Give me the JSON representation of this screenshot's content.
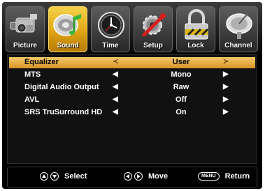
{
  "tabs": [
    {
      "label": "Picture",
      "icon": "camcorder-icon",
      "active": false
    },
    {
      "label": "Sound",
      "icon": "speaker-note-icon",
      "active": true
    },
    {
      "label": "Time",
      "icon": "clock-icon",
      "active": false
    },
    {
      "label": "Setup",
      "icon": "wrench-gear-icon",
      "active": false
    },
    {
      "label": "Lock",
      "icon": "padlock-icon",
      "active": false
    },
    {
      "label": "Channel",
      "icon": "satellite-dish-icon",
      "active": false
    }
  ],
  "menu": [
    {
      "label": "Equalizer",
      "value": "User",
      "selected": true
    },
    {
      "label": "MTS",
      "value": "Mono",
      "selected": false
    },
    {
      "label": "Digital Audio Output",
      "value": "Raw",
      "selected": false
    },
    {
      "label": "AVL",
      "value": "Off",
      "selected": false
    },
    {
      "label": "SRS TruSurround HD",
      "value": "On",
      "selected": false
    }
  ],
  "arrows": {
    "left": "◀",
    "right": "▶",
    "left_selected": "≺",
    "right_selected": "≻"
  },
  "footer": {
    "select_label": "Select",
    "move_label": "Move",
    "menu_key": "MENU",
    "return_label": "Return"
  },
  "colors": {
    "highlight": "#e0a514",
    "selected_row": "#d99426",
    "background": "#000000"
  }
}
